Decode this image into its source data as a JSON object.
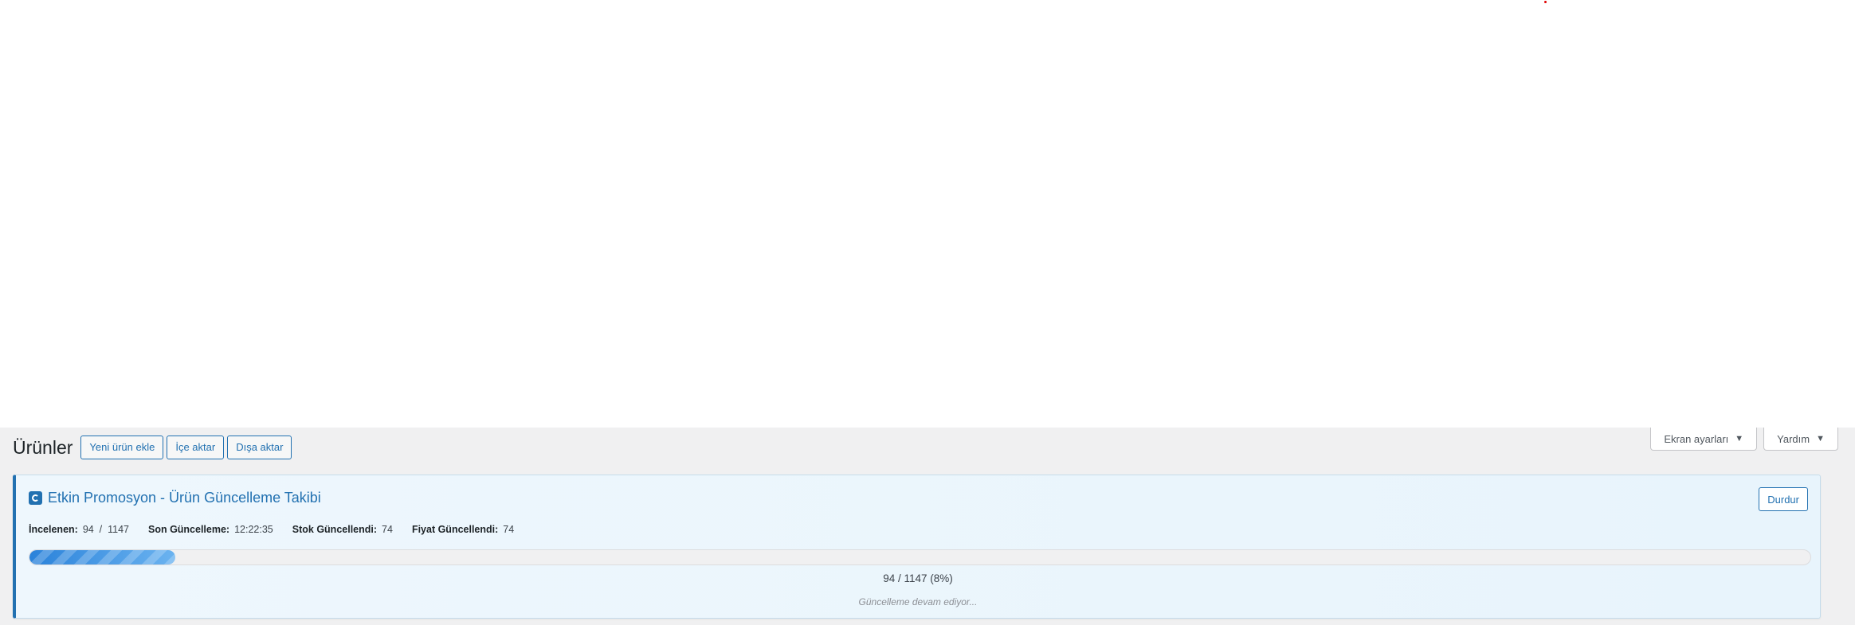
{
  "screen_meta": {
    "screen_options_label": "Ekran ayarları",
    "help_label": "Yardım"
  },
  "header": {
    "title": "Ürünler",
    "actions": {
      "add_new": "Yeni ürün ekle",
      "import": "İçe aktar",
      "export": "Dışa aktar"
    }
  },
  "tracker": {
    "title": "Etkin Promosyon - Ürün Güncelleme Takibi",
    "icon": "sync-icon",
    "stop_label": "Durdur",
    "stats": {
      "reviewed_label": "İncelenen:",
      "reviewed_value": "94  /  1147",
      "last_update_label": "Son Güncelleme:",
      "last_update_value": "12:22:35",
      "stock_label": "Stok Güncellendi:",
      "stock_value": "74",
      "price_label": "Fiyat Güncellendi:",
      "price_value": "74"
    },
    "progress": {
      "done": 94,
      "total": 1147,
      "percent": 8,
      "text": "94 / 1147 (8%)"
    },
    "status_text": "Güncelleme devam ediyor..."
  },
  "colors": {
    "accent": "#2271b1",
    "progress_start": "#2a82da",
    "progress_end": "#6bb3f0",
    "admin_bg": "#f0f0f1"
  }
}
